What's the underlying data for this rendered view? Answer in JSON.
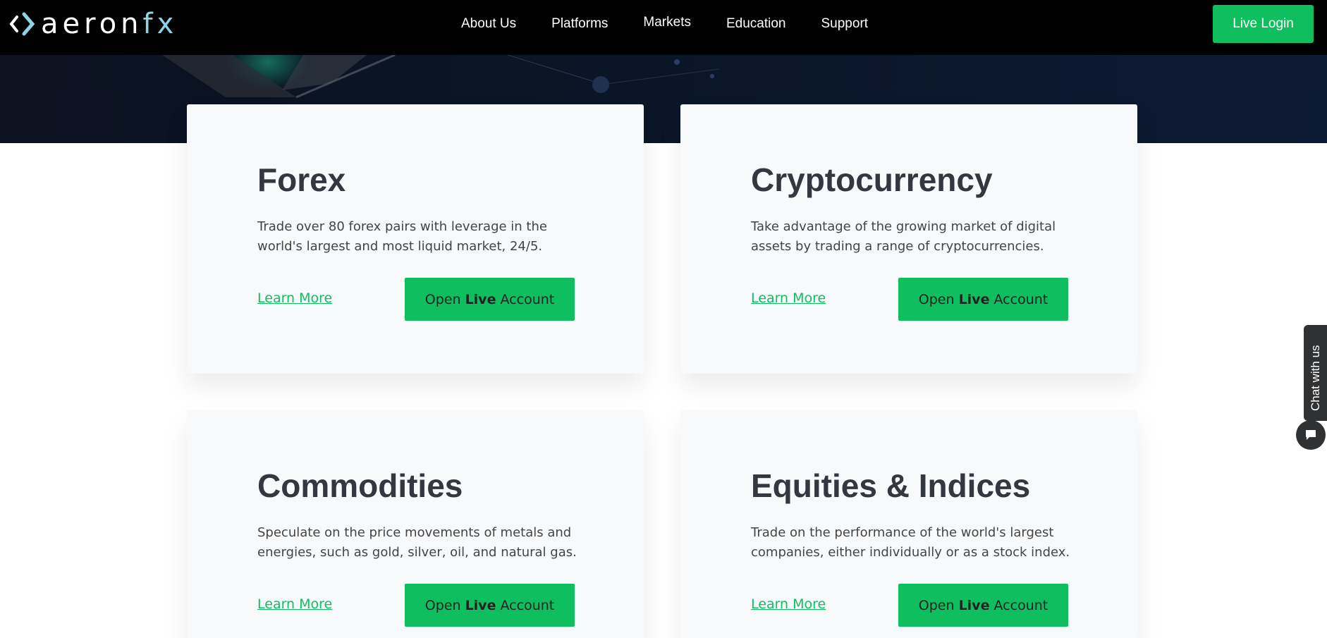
{
  "brand": {
    "logo_text": "aeron",
    "logo_fx": "fx",
    "accent_color": "#0fbf5f",
    "logo_fx_color": "#8fd3e6"
  },
  "nav": {
    "items": [
      "About Us",
      "Platforms",
      "Markets",
      "Education",
      "Support"
    ],
    "live_login": "Live Login"
  },
  "cards": [
    {
      "title": "Forex",
      "description_line1": "Trade over 80 forex pairs with leverage in the",
      "description_line2": "world's largest and most liquid market, 24/5.",
      "learn_more": "Learn More",
      "button_open": "Open ",
      "button_live": "Live",
      "button_account": " Account"
    },
    {
      "title": "Cryptocurrency",
      "description_line1": "Take advantage of the growing market of digital",
      "description_line2": "assets by trading a range of cryptocurrencies.",
      "learn_more": "Learn More",
      "button_open": "Open ",
      "button_live": "Live",
      "button_account": " Account"
    },
    {
      "title": "Commodities",
      "description_line1": "Speculate on the price movements of metals and",
      "description_line2": "energies, such as gold, silver, oil, and natural gas.",
      "learn_more": "Learn More",
      "button_open": "Open ",
      "button_live": "Live",
      "button_account": " Account"
    },
    {
      "title": "Equities & Indices",
      "description_line1": "Trade on the performance of the world's largest",
      "description_line2": "companies, either individually or as a stock index.",
      "learn_more": "Learn More",
      "button_open": "Open ",
      "button_live": "Live",
      "button_account": " Account"
    }
  ],
  "chat": {
    "label": "Chat with us",
    "icon": "chat-bubble-icon"
  }
}
